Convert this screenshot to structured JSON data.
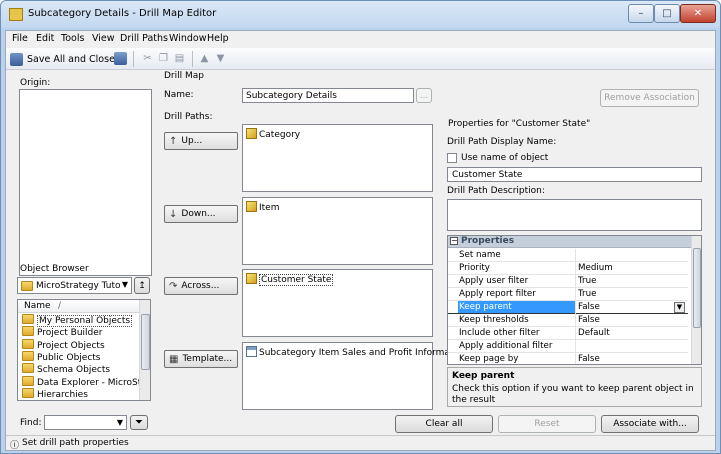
{
  "window": {
    "title": "Subcategory Details - Drill Map Editor",
    "controls": {
      "minimize": "–",
      "maximize": "□",
      "close": "✕"
    }
  },
  "menu": [
    "File",
    "Edit",
    "Tools",
    "View",
    "Drill Paths",
    "Window",
    "Help"
  ],
  "toolbar": {
    "save_all_close": "Save All and Close"
  },
  "origin": {
    "label": "Origin:"
  },
  "object_browser": {
    "label": "Object Browser",
    "dropdown": "MicroStrategy Tuto",
    "column_name": "Name",
    "column_sort": "/",
    "items": [
      {
        "label": "My Personal Objects",
        "selected": true
      },
      {
        "label": "Project Builder",
        "selected": false
      },
      {
        "label": "Project Objects",
        "selected": false
      },
      {
        "label": "Public Objects",
        "selected": false
      },
      {
        "label": "Schema Objects",
        "selected": false
      },
      {
        "label": "Data Explorer - MicroStrat",
        "selected": false
      },
      {
        "label": "Hierarchies",
        "selected": false
      }
    ],
    "find_label": "Find:"
  },
  "drill_map": {
    "group_label": "Drill Map",
    "name_label": "Name:",
    "name_value": "Subcategory Details",
    "browse_label": "...",
    "remove_association": "Remove Association",
    "drill_paths_label": "Drill Paths:",
    "paths": [
      {
        "button": "Up...",
        "item": "Category",
        "icon": "attribute-icon"
      },
      {
        "button": "Down...",
        "item": "Item",
        "icon": "attribute-icon"
      },
      {
        "button": "Across...",
        "item": "Customer State",
        "icon": "attribute-icon"
      },
      {
        "button": "Template...",
        "item": "Subcategory Item Sales and Profit Informat...",
        "icon": "report-icon"
      }
    ]
  },
  "properties_panel": {
    "group_label": "Properties for \"Customer State\"",
    "display_name_label": "Drill Path Display Name:",
    "use_name_label": "Use name of object",
    "display_name_value": "Customer State",
    "description_label": "Drill Path Description:",
    "grid_header": "Properties",
    "rows": [
      {
        "name": "Set name",
        "value": ""
      },
      {
        "name": "Priority",
        "value": "Medium"
      },
      {
        "name": "Apply user filter",
        "value": "True"
      },
      {
        "name": "Apply report filter",
        "value": "True"
      },
      {
        "name": "Keep parent",
        "value": "False",
        "selected": true
      },
      {
        "name": "Keep thresholds",
        "value": "False"
      },
      {
        "name": "Include other filter",
        "value": "Default"
      },
      {
        "name": "Apply additional filter",
        "value": ""
      },
      {
        "name": "Keep page by",
        "value": "False"
      }
    ],
    "help_title": "Keep parent",
    "help_text": "Check this option if you want to keep parent object in the result"
  },
  "bottom_buttons": {
    "clear_all": "Clear all",
    "reset": "Reset",
    "associate_with": "Associate with..."
  },
  "status": "Set drill path properties",
  "colors": {
    "selection": "#3399ff",
    "title_bar": "#c2d7ee"
  }
}
